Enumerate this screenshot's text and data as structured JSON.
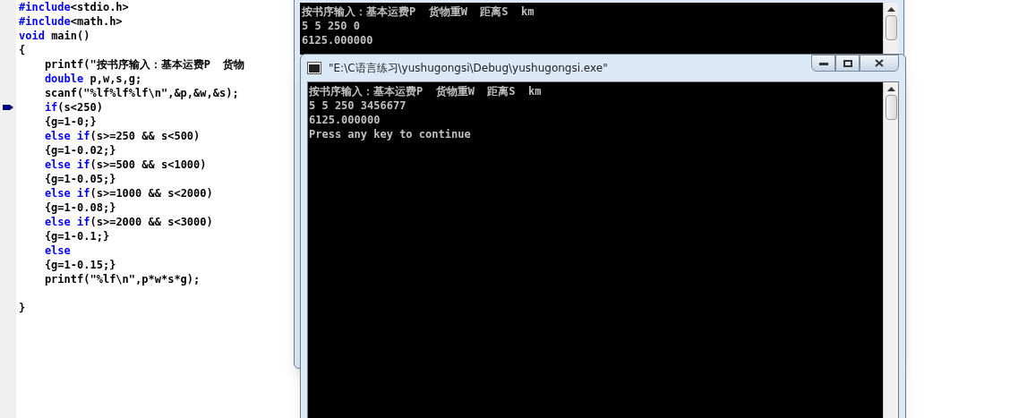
{
  "editor": {
    "lines": [
      {
        "kind": "code",
        "segments": [
          {
            "kind": "keyword",
            "text": "#include"
          },
          {
            "kind": "plain",
            "text": "<stdio.h>"
          }
        ]
      },
      {
        "kind": "code",
        "segments": [
          {
            "kind": "keyword",
            "text": "#include"
          },
          {
            "kind": "plain",
            "text": "<math.h>"
          }
        ]
      },
      {
        "kind": "code",
        "segments": [
          {
            "kind": "keyword",
            "text": "void"
          },
          {
            "kind": "plain",
            "text": " main()"
          }
        ]
      },
      {
        "kind": "code",
        "segments": [
          {
            "kind": "plain",
            "text": "{"
          }
        ]
      },
      {
        "kind": "code",
        "segments": [
          {
            "kind": "plain",
            "text": "    printf(\"按书序输入：基本运费P  货物"
          }
        ]
      },
      {
        "kind": "code",
        "segments": [
          {
            "kind": "keyword",
            "text": "    double"
          },
          {
            "kind": "plain",
            "text": " p,w,s,g;"
          }
        ]
      },
      {
        "kind": "code",
        "segments": [
          {
            "kind": "plain",
            "text": "    scanf(\"%lf%lf%lf\\n\",&p,&w,&s);"
          }
        ]
      },
      {
        "kind": "code",
        "marker": true,
        "segments": [
          {
            "kind": "keyword",
            "text": "    if"
          },
          {
            "kind": "plain",
            "text": "(s<250)"
          }
        ]
      },
      {
        "kind": "code",
        "segments": [
          {
            "kind": "plain",
            "text": "    {g=1-0;}"
          }
        ]
      },
      {
        "kind": "code",
        "segments": [
          {
            "kind": "keyword",
            "text": "    else if"
          },
          {
            "kind": "plain",
            "text": "(s>=250 && s<500)"
          }
        ]
      },
      {
        "kind": "code",
        "segments": [
          {
            "kind": "plain",
            "text": "    {g=1-0.02;}"
          }
        ]
      },
      {
        "kind": "code",
        "segments": [
          {
            "kind": "keyword",
            "text": "    else if"
          },
          {
            "kind": "plain",
            "text": "(s>=500 && s<1000)"
          }
        ]
      },
      {
        "kind": "code",
        "segments": [
          {
            "kind": "plain",
            "text": "    {g=1-0.05;}"
          }
        ]
      },
      {
        "kind": "code",
        "segments": [
          {
            "kind": "keyword",
            "text": "    else if"
          },
          {
            "kind": "plain",
            "text": "(s>=1000 && s<2000)"
          }
        ]
      },
      {
        "kind": "code",
        "segments": [
          {
            "kind": "plain",
            "text": "    {g=1-0.08;}"
          }
        ]
      },
      {
        "kind": "code",
        "segments": [
          {
            "kind": "keyword",
            "text": "    else if"
          },
          {
            "kind": "plain",
            "text": "(s>=2000 && s<3000)"
          }
        ]
      },
      {
        "kind": "code",
        "segments": [
          {
            "kind": "plain",
            "text": "    {g=1-0.1;}"
          }
        ]
      },
      {
        "kind": "code",
        "segments": [
          {
            "kind": "keyword",
            "text": "    else"
          }
        ]
      },
      {
        "kind": "code",
        "segments": [
          {
            "kind": "plain",
            "text": "    {g=1-0.15;}"
          }
        ]
      },
      {
        "kind": "code",
        "segments": [
          {
            "kind": "plain",
            "text": "    printf(\"%lf\\n\",p*w*s*g);"
          }
        ]
      },
      {
        "kind": "blank"
      },
      {
        "kind": "code",
        "segments": [
          {
            "kind": "plain",
            "text": "}"
          }
        ]
      }
    ]
  },
  "back_console": {
    "lines": [
      "按书序输入：基本运费P  货物重W  距离S  km",
      "5 5 250 0",
      "6125.000000"
    ]
  },
  "front_console": {
    "title": "\"E:\\C语言练习\\yushugongsi\\Debug\\yushugongsi.exe\"",
    "lines": [
      "按书序输入：基本运费P  货物重W  距离S  km",
      "5 5 250 3456677",
      "6125.000000",
      "Press any key to continue"
    ]
  }
}
